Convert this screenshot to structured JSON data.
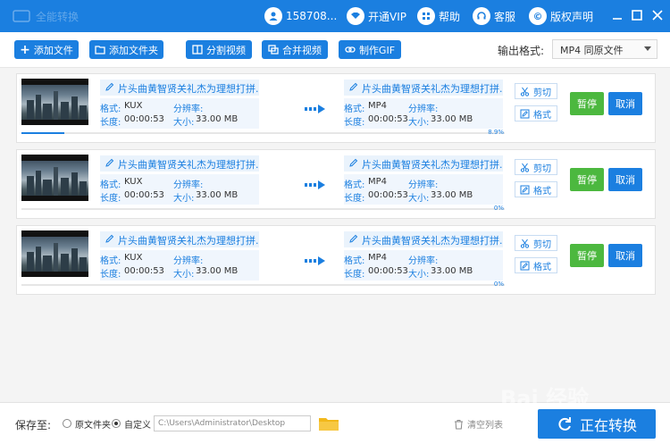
{
  "titlebar": {
    "app_name": "全能转换",
    "user": "158708...",
    "vip_label": "开通VIP",
    "help_label": "帮助",
    "service_label": "客服",
    "copyright_label": "版权声明"
  },
  "toolbar": {
    "add_file": "添加文件",
    "add_folder": "添加文件夹",
    "split_video": "分割视频",
    "merge_video": "合并视频",
    "make_gif": "制作GIF",
    "output_format_label": "输出格式:",
    "output_format_value": "MP4  同原文件"
  },
  "labels": {
    "format": "格式:",
    "resolution": "分辨率:",
    "duration": "长度:",
    "size": "大小:",
    "cut": "剪切",
    "format_btn": "格式",
    "pause": "暂停",
    "cancel": "取消"
  },
  "items": [
    {
      "src_name": "片头曲黄智贤关礼杰为理想打拼.",
      "src_format": "KUX",
      "src_duration": "00:00:53",
      "src_size": "33.00 MB",
      "dst_name": "片头曲黄智贤关礼杰为理想打拼.",
      "dst_format": "MP4",
      "dst_duration": "00:00:53",
      "dst_size": "33.00 MB",
      "progress_text": "8.9%",
      "progress": 0.089
    },
    {
      "src_name": "片头曲黄智贤关礼杰为理想打拼.",
      "src_format": "KUX",
      "src_duration": "00:00:53",
      "src_size": "33.00 MB",
      "dst_name": "片头曲黄智贤关礼杰为理想打拼.",
      "dst_format": "MP4",
      "dst_duration": "00:00:53",
      "dst_size": "33.00 MB",
      "progress_text": "0%",
      "progress": 0
    },
    {
      "src_name": "片头曲黄智贤关礼杰为理想打拼.",
      "src_format": "KUX",
      "src_duration": "00:00:53",
      "src_size": "33.00 MB",
      "dst_name": "片头曲黄智贤关礼杰为理想打拼.",
      "dst_format": "MP4",
      "dst_duration": "00:00:53",
      "dst_size": "33.00 MB",
      "progress_text": "0%",
      "progress": 0
    }
  ],
  "bottom": {
    "save_to": "保存至:",
    "original_folder": "原文件夹",
    "custom": "自定义",
    "path": "C:\\Users\\Administrator\\Desktop",
    "clear_list": "清空列表",
    "converting": "正在转换"
  },
  "watermark": "Bai 经验",
  "colors": {
    "accent": "#1b7fe0",
    "pause": "#4cb83f"
  }
}
